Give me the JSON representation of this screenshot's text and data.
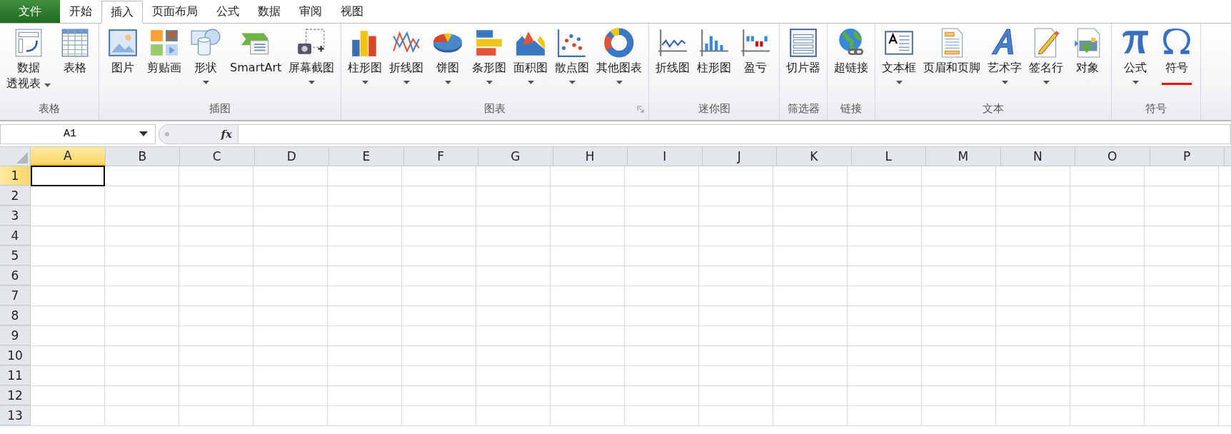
{
  "file_tab": {
    "label": "文件"
  },
  "tabs": [
    {
      "label": "开始",
      "selected": false
    },
    {
      "label": "插入",
      "selected": true
    },
    {
      "label": "页面布局",
      "selected": false
    },
    {
      "label": "公式",
      "selected": false
    },
    {
      "label": "数据",
      "selected": false
    },
    {
      "label": "审阅",
      "selected": false
    },
    {
      "label": "视图",
      "selected": false
    }
  ],
  "ribbon_groups": [
    {
      "label": "表格",
      "launcher": false,
      "buttons": [
        {
          "kind": "pivot",
          "lines": [
            "数据",
            "透视表"
          ],
          "dropdown": true,
          "underlined": false
        },
        {
          "kind": "table",
          "lines": [
            "表格"
          ],
          "dropdown": false,
          "underlined": false
        }
      ]
    },
    {
      "label": "插图",
      "launcher": false,
      "buttons": [
        {
          "kind": "picture",
          "lines": [
            "图片"
          ],
          "dropdown": false,
          "underlined": false
        },
        {
          "kind": "clipart",
          "lines": [
            "剪贴画"
          ],
          "dropdown": false,
          "underlined": false
        },
        {
          "kind": "shapes",
          "lines": [
            "形状"
          ],
          "dropdown": true,
          "underlined": false
        },
        {
          "kind": "smartart",
          "lines": [
            "SmartArt"
          ],
          "dropdown": false,
          "underlined": false
        },
        {
          "kind": "screenshot",
          "lines": [
            "屏幕截图"
          ],
          "dropdown": true,
          "underlined": false
        }
      ]
    },
    {
      "label": "图表",
      "launcher": true,
      "buttons": [
        {
          "kind": "column",
          "lines": [
            "柱形图"
          ],
          "dropdown": true,
          "underlined": false
        },
        {
          "kind": "line",
          "lines": [
            "折线图"
          ],
          "dropdown": true,
          "underlined": false
        },
        {
          "kind": "pie",
          "lines": [
            "饼图"
          ],
          "dropdown": true,
          "underlined": false
        },
        {
          "kind": "bar",
          "lines": [
            "条形图"
          ],
          "dropdown": true,
          "underlined": false
        },
        {
          "kind": "area",
          "lines": [
            "面积图"
          ],
          "dropdown": true,
          "underlined": false
        },
        {
          "kind": "scatter",
          "lines": [
            "散点图"
          ],
          "dropdown": true,
          "underlined": false
        },
        {
          "kind": "donut",
          "lines": [
            "其他图表"
          ],
          "dropdown": true,
          "underlined": false
        }
      ]
    },
    {
      "label": "迷你图",
      "launcher": false,
      "buttons": [
        {
          "kind": "spark_line",
          "lines": [
            "折线图"
          ],
          "dropdown": false,
          "underlined": false
        },
        {
          "kind": "spark_column",
          "lines": [
            "柱形图"
          ],
          "dropdown": false,
          "underlined": false
        },
        {
          "kind": "spark_winloss",
          "lines": [
            "盈亏"
          ],
          "dropdown": false,
          "underlined": false
        }
      ]
    },
    {
      "label": "筛选器",
      "launcher": false,
      "buttons": [
        {
          "kind": "slicer",
          "lines": [
            "切片器"
          ],
          "dropdown": false,
          "underlined": false
        }
      ]
    },
    {
      "label": "链接",
      "launcher": false,
      "buttons": [
        {
          "kind": "hyperlink",
          "lines": [
            "超链接"
          ],
          "dropdown": false,
          "underlined": false
        }
      ]
    },
    {
      "label": "文本",
      "launcher": false,
      "buttons": [
        {
          "kind": "textbox",
          "lines": [
            "文本框"
          ],
          "dropdown": true,
          "underlined": false
        },
        {
          "kind": "header",
          "lines": [
            "页眉和页脚"
          ],
          "dropdown": false,
          "underlined": false
        },
        {
          "kind": "wordart",
          "lines": [
            "艺术字"
          ],
          "dropdown": true,
          "underlined": false
        },
        {
          "kind": "signature",
          "lines": [
            "签名行"
          ],
          "dropdown": true,
          "underlined": false
        },
        {
          "kind": "object",
          "lines": [
            "对象"
          ],
          "dropdown": false,
          "underlined": false
        }
      ]
    },
    {
      "label": "符号",
      "launcher": false,
      "buttons": [
        {
          "kind": "equation",
          "lines": [
            "公式"
          ],
          "dropdown": true,
          "underlined": false
        },
        {
          "kind": "symbol",
          "lines": [
            "符号"
          ],
          "dropdown": false,
          "underlined": true
        }
      ]
    }
  ],
  "formula_bar": {
    "name_box": "A1",
    "fx": "fx"
  },
  "columns": [
    {
      "label": "A",
      "selected": true
    },
    {
      "label": "B",
      "selected": false
    },
    {
      "label": "C",
      "selected": false
    },
    {
      "label": "D",
      "selected": false
    },
    {
      "label": "E",
      "selected": false
    },
    {
      "label": "F",
      "selected": false
    },
    {
      "label": "G",
      "selected": false
    },
    {
      "label": "H",
      "selected": false
    },
    {
      "label": "I",
      "selected": false
    },
    {
      "label": "J",
      "selected": false
    },
    {
      "label": "K",
      "selected": false
    },
    {
      "label": "L",
      "selected": false
    },
    {
      "label": "M",
      "selected": false
    },
    {
      "label": "N",
      "selected": false
    },
    {
      "label": "O",
      "selected": false
    },
    {
      "label": "P",
      "selected": false
    }
  ],
  "rows": [
    {
      "label": "1",
      "selected": true
    },
    {
      "label": "2",
      "selected": false
    },
    {
      "label": "3",
      "selected": false
    },
    {
      "label": "4",
      "selected": false
    },
    {
      "label": "5",
      "selected": false
    },
    {
      "label": "6",
      "selected": false
    },
    {
      "label": "7",
      "selected": false
    },
    {
      "label": "8",
      "selected": false
    },
    {
      "label": "9",
      "selected": false
    },
    {
      "label": "10",
      "selected": false
    },
    {
      "label": "11",
      "selected": false
    },
    {
      "label": "12",
      "selected": false
    },
    {
      "label": "13",
      "selected": false
    }
  ]
}
